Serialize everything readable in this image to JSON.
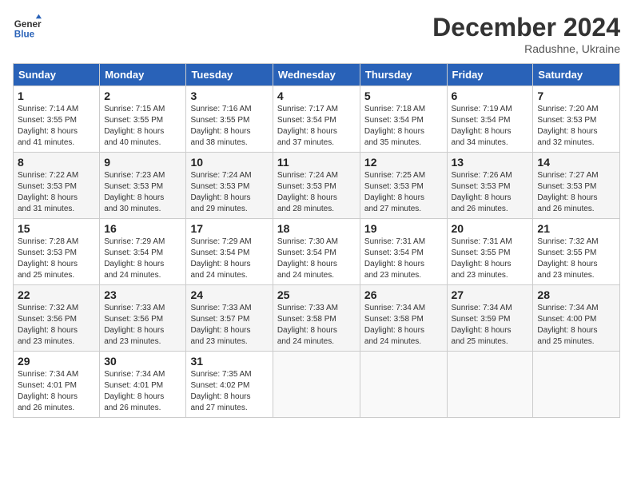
{
  "header": {
    "logo_line1": "General",
    "logo_line2": "Blue",
    "month_title": "December 2024",
    "location": "Radushne, Ukraine"
  },
  "weekdays": [
    "Sunday",
    "Monday",
    "Tuesday",
    "Wednesday",
    "Thursday",
    "Friday",
    "Saturday"
  ],
  "weeks": [
    [
      {
        "day": "1",
        "info": "Sunrise: 7:14 AM\nSunset: 3:55 PM\nDaylight: 8 hours\nand 41 minutes."
      },
      {
        "day": "2",
        "info": "Sunrise: 7:15 AM\nSunset: 3:55 PM\nDaylight: 8 hours\nand 40 minutes."
      },
      {
        "day": "3",
        "info": "Sunrise: 7:16 AM\nSunset: 3:55 PM\nDaylight: 8 hours\nand 38 minutes."
      },
      {
        "day": "4",
        "info": "Sunrise: 7:17 AM\nSunset: 3:54 PM\nDaylight: 8 hours\nand 37 minutes."
      },
      {
        "day": "5",
        "info": "Sunrise: 7:18 AM\nSunset: 3:54 PM\nDaylight: 8 hours\nand 35 minutes."
      },
      {
        "day": "6",
        "info": "Sunrise: 7:19 AM\nSunset: 3:54 PM\nDaylight: 8 hours\nand 34 minutes."
      },
      {
        "day": "7",
        "info": "Sunrise: 7:20 AM\nSunset: 3:53 PM\nDaylight: 8 hours\nand 32 minutes."
      }
    ],
    [
      {
        "day": "8",
        "info": "Sunrise: 7:22 AM\nSunset: 3:53 PM\nDaylight: 8 hours\nand 31 minutes."
      },
      {
        "day": "9",
        "info": "Sunrise: 7:23 AM\nSunset: 3:53 PM\nDaylight: 8 hours\nand 30 minutes."
      },
      {
        "day": "10",
        "info": "Sunrise: 7:24 AM\nSunset: 3:53 PM\nDaylight: 8 hours\nand 29 minutes."
      },
      {
        "day": "11",
        "info": "Sunrise: 7:24 AM\nSunset: 3:53 PM\nDaylight: 8 hours\nand 28 minutes."
      },
      {
        "day": "12",
        "info": "Sunrise: 7:25 AM\nSunset: 3:53 PM\nDaylight: 8 hours\nand 27 minutes."
      },
      {
        "day": "13",
        "info": "Sunrise: 7:26 AM\nSunset: 3:53 PM\nDaylight: 8 hours\nand 26 minutes."
      },
      {
        "day": "14",
        "info": "Sunrise: 7:27 AM\nSunset: 3:53 PM\nDaylight: 8 hours\nand 26 minutes."
      }
    ],
    [
      {
        "day": "15",
        "info": "Sunrise: 7:28 AM\nSunset: 3:53 PM\nDaylight: 8 hours\nand 25 minutes."
      },
      {
        "day": "16",
        "info": "Sunrise: 7:29 AM\nSunset: 3:54 PM\nDaylight: 8 hours\nand 24 minutes."
      },
      {
        "day": "17",
        "info": "Sunrise: 7:29 AM\nSunset: 3:54 PM\nDaylight: 8 hours\nand 24 minutes."
      },
      {
        "day": "18",
        "info": "Sunrise: 7:30 AM\nSunset: 3:54 PM\nDaylight: 8 hours\nand 24 minutes."
      },
      {
        "day": "19",
        "info": "Sunrise: 7:31 AM\nSunset: 3:54 PM\nDaylight: 8 hours\nand 23 minutes."
      },
      {
        "day": "20",
        "info": "Sunrise: 7:31 AM\nSunset: 3:55 PM\nDaylight: 8 hours\nand 23 minutes."
      },
      {
        "day": "21",
        "info": "Sunrise: 7:32 AM\nSunset: 3:55 PM\nDaylight: 8 hours\nand 23 minutes."
      }
    ],
    [
      {
        "day": "22",
        "info": "Sunrise: 7:32 AM\nSunset: 3:56 PM\nDaylight: 8 hours\nand 23 minutes."
      },
      {
        "day": "23",
        "info": "Sunrise: 7:33 AM\nSunset: 3:56 PM\nDaylight: 8 hours\nand 23 minutes."
      },
      {
        "day": "24",
        "info": "Sunrise: 7:33 AM\nSunset: 3:57 PM\nDaylight: 8 hours\nand 23 minutes."
      },
      {
        "day": "25",
        "info": "Sunrise: 7:33 AM\nSunset: 3:58 PM\nDaylight: 8 hours\nand 24 minutes."
      },
      {
        "day": "26",
        "info": "Sunrise: 7:34 AM\nSunset: 3:58 PM\nDaylight: 8 hours\nand 24 minutes."
      },
      {
        "day": "27",
        "info": "Sunrise: 7:34 AM\nSunset: 3:59 PM\nDaylight: 8 hours\nand 25 minutes."
      },
      {
        "day": "28",
        "info": "Sunrise: 7:34 AM\nSunset: 4:00 PM\nDaylight: 8 hours\nand 25 minutes."
      }
    ],
    [
      {
        "day": "29",
        "info": "Sunrise: 7:34 AM\nSunset: 4:01 PM\nDaylight: 8 hours\nand 26 minutes."
      },
      {
        "day": "30",
        "info": "Sunrise: 7:34 AM\nSunset: 4:01 PM\nDaylight: 8 hours\nand 26 minutes."
      },
      {
        "day": "31",
        "info": "Sunrise: 7:35 AM\nSunset: 4:02 PM\nDaylight: 8 hours\nand 27 minutes."
      },
      null,
      null,
      null,
      null
    ]
  ]
}
